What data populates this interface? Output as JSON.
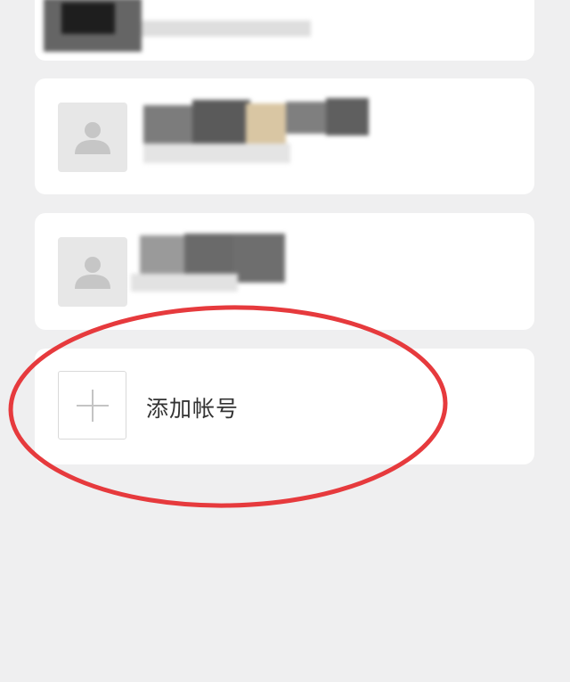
{
  "accounts": [
    {
      "name": "",
      "avatar_icon": "person-silhouette-icon"
    },
    {
      "name": "",
      "avatar_icon": "person-silhouette-icon"
    },
    {
      "name": "",
      "avatar_icon": "person-silhouette-icon"
    }
  ],
  "add_account": {
    "label": "添加帐号",
    "icon": "plus-icon"
  },
  "colors": {
    "page_bg": "#efeff0",
    "card_bg": "#ffffff",
    "avatar_bg": "#e7e7e7",
    "silhouette": "#c6c6c6",
    "highlight_ring": "#e63a3d"
  }
}
